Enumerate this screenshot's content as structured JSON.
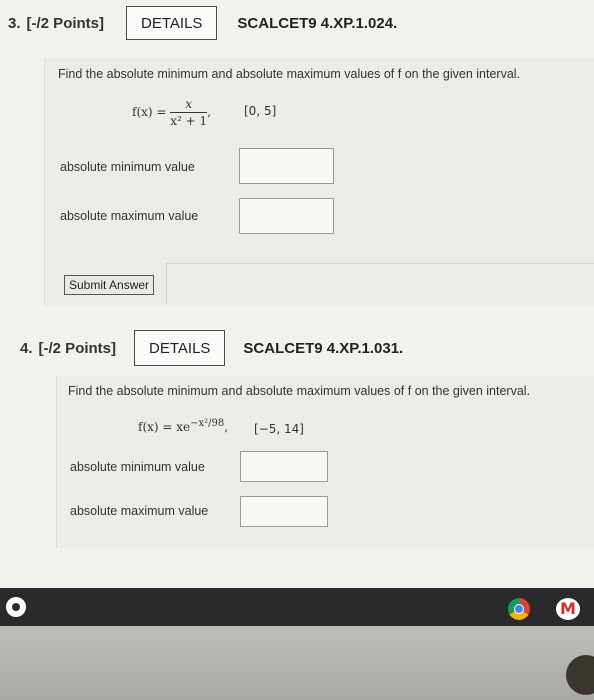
{
  "questions": [
    {
      "number": "3.",
      "points": "[-/2 Points]",
      "details_label": "DETAILS",
      "code": "SCALCET9 4.XP.1.024.",
      "prompt": "Find the absolute minimum and absolute maximum values of f on the given interval.",
      "function_lhs": "f(x) =",
      "numerator": "x",
      "denominator": "x² + 1",
      "interval": "[0, 5]",
      "min_label": "absolute minimum value",
      "max_label": "absolute maximum value",
      "min_value": "",
      "max_value": "",
      "submit_label": "Submit Answer"
    },
    {
      "number": "4.",
      "points": "[-/2 Points]",
      "details_label": "DETAILS",
      "code": "SCALCET9 4.XP.1.031.",
      "prompt": "Find the absolute minimum and absolute maximum values of f on the given interval.",
      "function_text": "f(x) = xe",
      "exponent": "−x²/98",
      "interval": "[−5, 14]",
      "min_label": "absolute minimum value",
      "max_label": "absolute maximum value",
      "min_value": "",
      "max_value": ""
    }
  ],
  "taskbar": {
    "icons": [
      "launcher-icon",
      "chrome-icon",
      "gmail-icon"
    ],
    "gmail_glyph": "M"
  },
  "colors": {
    "page_bg": "#f2f1ec",
    "taskbar_bg": "#2a2a2c"
  }
}
